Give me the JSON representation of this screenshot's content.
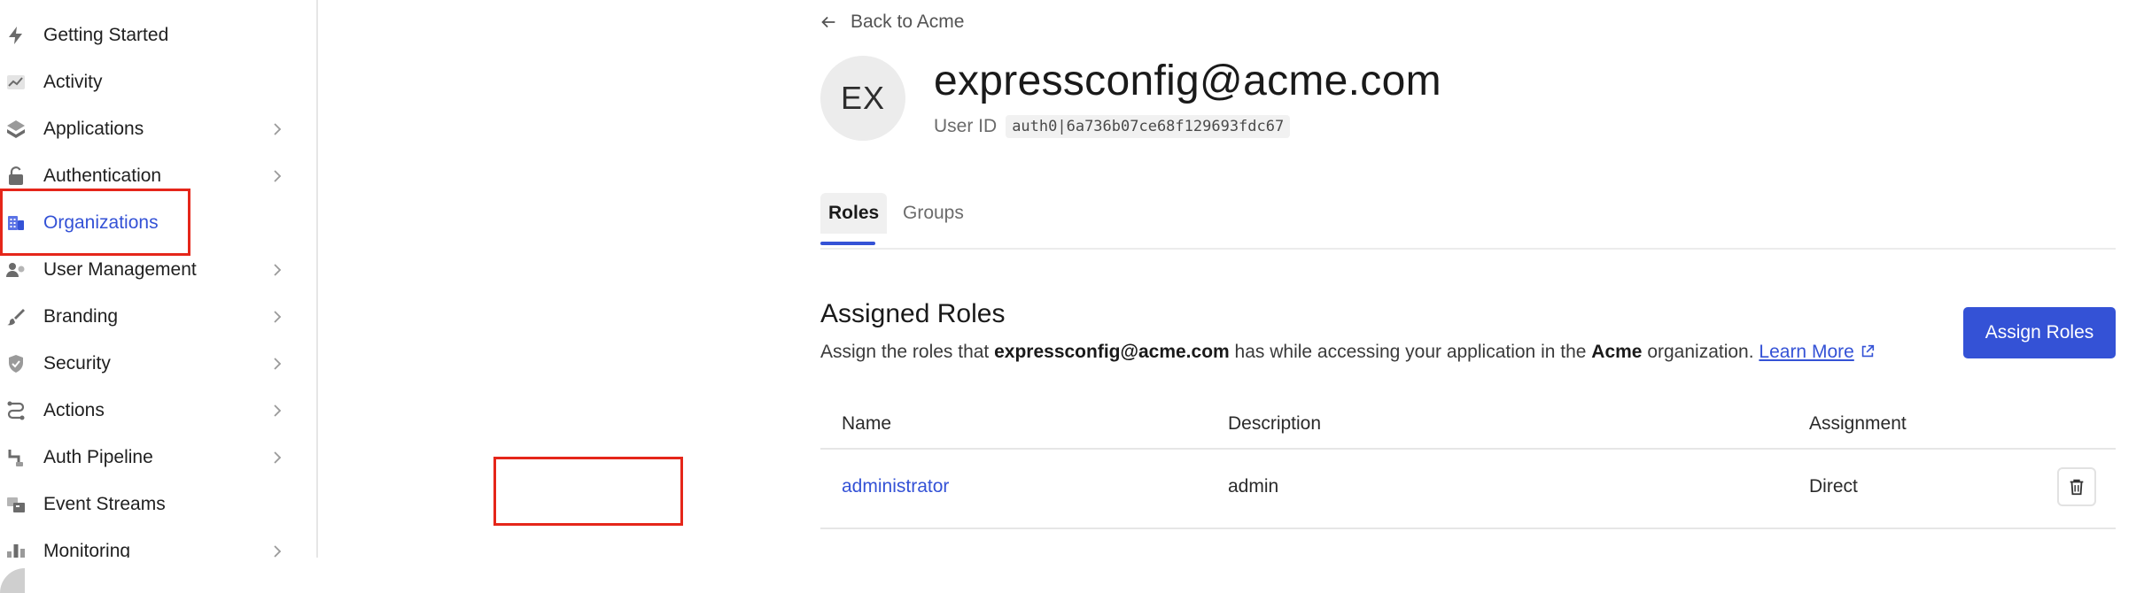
{
  "sidebar": {
    "items": [
      {
        "label": "Getting Started",
        "icon": "bolt-icon",
        "chevron": false
      },
      {
        "label": "Activity",
        "icon": "activity-chart-icon",
        "chevron": false
      },
      {
        "label": "Applications",
        "icon": "layers-icon",
        "chevron": true
      },
      {
        "label": "Authentication",
        "icon": "unlock-icon",
        "chevron": true
      },
      {
        "label": "Organizations",
        "icon": "building-icon",
        "chevron": false,
        "active": true
      },
      {
        "label": "User Management",
        "icon": "users-icon",
        "chevron": true
      },
      {
        "label": "Branding",
        "icon": "brush-icon",
        "chevron": true
      },
      {
        "label": "Security",
        "icon": "shield-check-icon",
        "chevron": true
      },
      {
        "label": "Actions",
        "icon": "flow-icon",
        "chevron": true
      },
      {
        "label": "Auth Pipeline",
        "icon": "pipeline-icon",
        "chevron": true
      },
      {
        "label": "Event Streams",
        "icon": "event-streams-icon",
        "chevron": false
      },
      {
        "label": "Monitoring",
        "icon": "bar-chart-icon",
        "chevron": true
      }
    ]
  },
  "header": {
    "back_label": "Back to Acme",
    "avatar_initials": "EX",
    "user_email": "expressconfig@acme.com",
    "user_id_label": "User ID",
    "user_id_value": "auth0|6a736b07ce68f129693fdc67"
  },
  "tabs": [
    {
      "label": "Roles",
      "active": true
    },
    {
      "label": "Groups",
      "active": false
    }
  ],
  "roles_section": {
    "title": "Assigned Roles",
    "desc_prefix": "Assign the roles that ",
    "desc_user": "expressconfig@acme.com",
    "desc_middle": " has while accessing your application in the ",
    "desc_org": "Acme",
    "desc_suffix": " organization. ",
    "learn_more": "Learn More",
    "assign_button": "Assign Roles"
  },
  "table": {
    "columns": [
      "Name",
      "Description",
      "Assignment"
    ],
    "rows": [
      {
        "name": "administrator",
        "description": "admin",
        "assignment": "Direct"
      }
    ]
  },
  "colors": {
    "accent": "#3452d6",
    "highlight": "#e5261a"
  }
}
